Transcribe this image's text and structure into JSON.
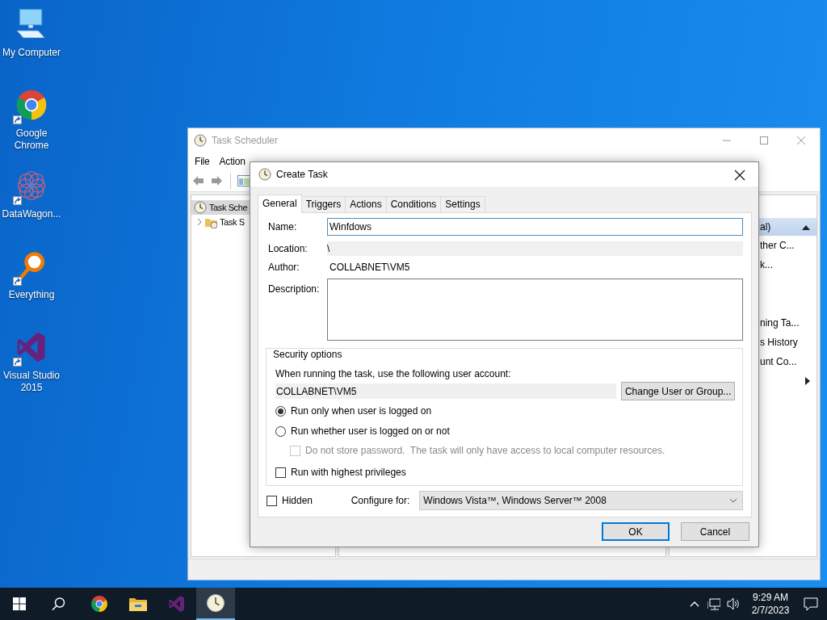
{
  "desktop_icons": [
    {
      "label": "My Computer",
      "kind": "computer",
      "shortcut": false
    },
    {
      "label": "Google Chrome",
      "kind": "chrome",
      "shortcut": true
    },
    {
      "label": "DataWagon...",
      "kind": "datawagon",
      "shortcut": true
    },
    {
      "label": "Everything",
      "kind": "everything",
      "shortcut": true
    },
    {
      "label": "Visual Studio 2015",
      "kind": "visualstudio",
      "shortcut": true
    }
  ],
  "main_window": {
    "title": "Task Scheduler",
    "menu": [
      "File",
      "Action"
    ],
    "tree": [
      {
        "label": "Task Sche",
        "selected": true,
        "children": [
          {
            "label": "Task S",
            "selected": false
          }
        ]
      }
    ],
    "actions_pane": {
      "header": "al)",
      "groups": [
        {
          "items": [
            {
              "kind": "action",
              "label": "ther C..."
            },
            {
              "kind": "action",
              "label": "k..."
            }
          ]
        },
        {
          "items": [
            {
              "kind": "action",
              "label": "ning Ta..."
            },
            {
              "kind": "action",
              "label": "s History"
            },
            {
              "kind": "action",
              "label": "unt Co..."
            },
            {
              "kind": "submenu"
            }
          ]
        }
      ]
    }
  },
  "dialog": {
    "title": "Create Task",
    "tabs": [
      {
        "label": "General",
        "selected": true
      },
      {
        "label": "Triggers",
        "selected": false
      },
      {
        "label": "Actions",
        "selected": false
      },
      {
        "label": "Conditions",
        "selected": false
      },
      {
        "label": "Settings",
        "selected": false
      }
    ],
    "name": {
      "label": "Name:",
      "value": "Winfdows"
    },
    "location": {
      "label": "Location:",
      "value": "\\"
    },
    "author": {
      "label": "Author:",
      "value": "COLLABNET\\VM5"
    },
    "description": {
      "label": "Description:"
    },
    "security": {
      "legend": "Security options",
      "prompt": "When running the task, use the following user account:",
      "account": "COLLABNET\\VM5",
      "change_button": "Change User or Group...",
      "options": [
        {
          "kind": "radio",
          "label": "Run only when user is logged on",
          "selected": true,
          "disabled": false
        },
        {
          "kind": "radio",
          "label": "Run whether user is logged on or not",
          "selected": false,
          "disabled": false,
          "children": [
            {
              "kind": "checkbox",
              "label": "Do not store password.  The task will only have access to local computer resources.",
              "checked": false,
              "disabled": true
            }
          ]
        },
        {
          "kind": "checkbox",
          "label": "Run with highest privileges",
          "checked": false,
          "disabled": false
        }
      ]
    },
    "hidden": {
      "label": "Hidden",
      "checked": false
    },
    "configure": {
      "label": "Configure for:",
      "value": "Windows Vista™, Windows Server™ 2008"
    },
    "buttons": [
      {
        "label": "OK",
        "default": true
      },
      {
        "label": "Cancel",
        "default": false
      }
    ]
  },
  "taskbar": {
    "apps": [
      {
        "kind": "chrome",
        "active": false
      },
      {
        "kind": "folder",
        "active": false
      },
      {
        "kind": "visualstudio",
        "active": false
      },
      {
        "kind": "scheduler",
        "active": true
      }
    ],
    "clock": {
      "time": "9:29 AM",
      "date": "2/7/2023"
    }
  }
}
